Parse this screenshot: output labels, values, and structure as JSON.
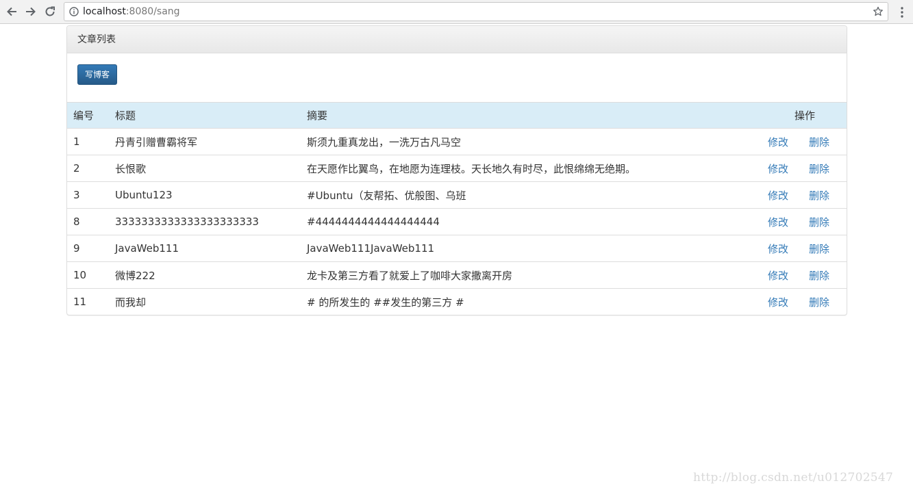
{
  "browser": {
    "url_host": "localhost",
    "url_rest": ":8080/sang"
  },
  "panel": {
    "title": "文章列表",
    "write_button_label": "写博客"
  },
  "table": {
    "headers": {
      "id": "编号",
      "title": "标题",
      "summary": "摘要",
      "ops": "操作"
    },
    "rows": [
      {
        "id": "1",
        "title": "丹青引赠曹霸将军",
        "summary": "斯须九重真龙出，一洗万古凡马空",
        "edit": "修改",
        "delete": "删除"
      },
      {
        "id": "2",
        "title": "长恨歌",
        "summary": "在天愿作比翼鸟，在地愿为连理枝。天长地久有时尽，此恨绵绵无绝期。",
        "edit": "修改",
        "delete": "删除"
      },
      {
        "id": "3",
        "title": "Ubuntu123",
        "summary": "#Ubuntu（友帮拓、优般图、乌班",
        "edit": "修改",
        "delete": "删除"
      },
      {
        "id": "8",
        "title": "3333333333333333333333",
        "summary": "#4444444444444444444",
        "edit": "修改",
        "delete": "删除"
      },
      {
        "id": "9",
        "title": "JavaWeb111",
        "summary": "JavaWeb111JavaWeb111",
        "edit": "修改",
        "delete": "删除"
      },
      {
        "id": "10",
        "title": "微博222",
        "summary": "龙卡及第三方看了就爱上了咖啡大家撒离开房",
        "edit": "修改",
        "delete": "删除"
      },
      {
        "id": "11",
        "title": "而我却",
        "summary": "# 的所发生的 ##发生的第三方 #",
        "edit": "修改",
        "delete": "删除"
      }
    ]
  },
  "watermark": {
    "text": "http://blog.csdn.net/u012702547"
  },
  "colors": {
    "link": "#337ab7",
    "header_row_bg": "#d9edf7",
    "button_bg": "#337ab7"
  }
}
